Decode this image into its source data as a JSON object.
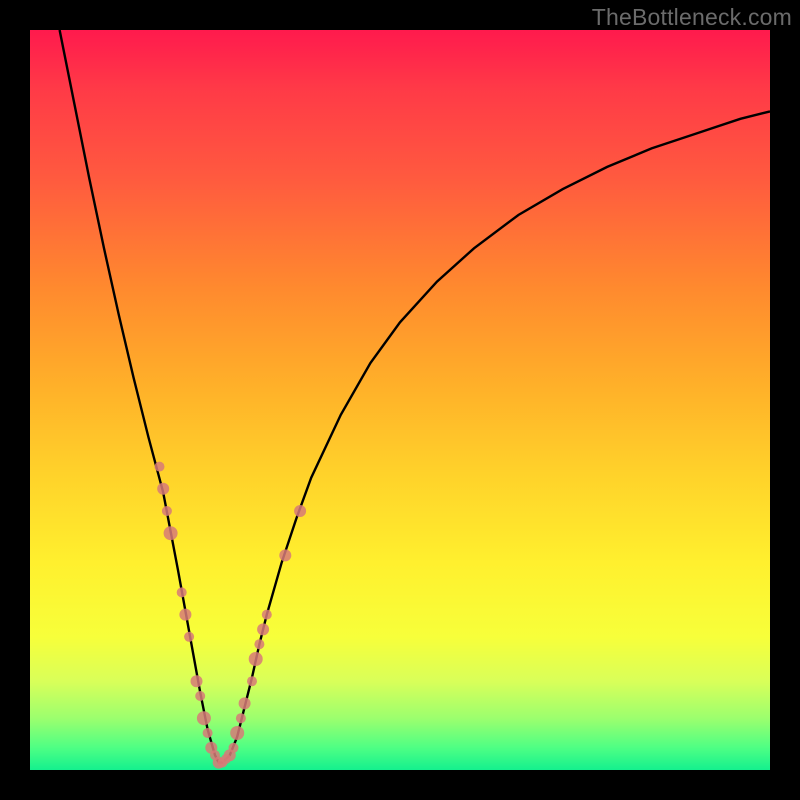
{
  "watermark": "TheBottleneck.com",
  "chart_data": {
    "type": "line",
    "title": "",
    "xlabel": "",
    "ylabel": "",
    "xlim": [
      0,
      100
    ],
    "ylim": [
      0,
      100
    ],
    "grid": false,
    "curve": {
      "name": "bottleneck-curve",
      "color": "#000000",
      "x": [
        4,
        6,
        8,
        10,
        12,
        14,
        16,
        18,
        20,
        21,
        22,
        23,
        24,
        25,
        25.5,
        26,
        27,
        28,
        29,
        30,
        31,
        32,
        34,
        36,
        38,
        42,
        46,
        50,
        55,
        60,
        66,
        72,
        78,
        84,
        90,
        96,
        100
      ],
      "y": [
        100,
        90,
        80,
        70.5,
        61.5,
        53,
        45,
        37.5,
        27,
        21.5,
        16,
        10.5,
        5.5,
        2,
        1,
        1,
        2,
        4.5,
        8.5,
        12.5,
        17,
        21,
        28,
        34,
        39.5,
        48,
        55,
        60.5,
        66,
        70.5,
        75,
        78.5,
        81.5,
        84,
        86,
        88,
        89
      ]
    },
    "scatter": {
      "name": "data-points",
      "color": "#d77a78",
      "points": [
        {
          "x": 17.5,
          "y": 41,
          "r": 5
        },
        {
          "x": 18.0,
          "y": 38,
          "r": 6
        },
        {
          "x": 18.5,
          "y": 35,
          "r": 5
        },
        {
          "x": 19.0,
          "y": 32,
          "r": 7
        },
        {
          "x": 20.5,
          "y": 24,
          "r": 5
        },
        {
          "x": 21.0,
          "y": 21,
          "r": 6
        },
        {
          "x": 21.5,
          "y": 18,
          "r": 5
        },
        {
          "x": 22.5,
          "y": 12,
          "r": 6
        },
        {
          "x": 23.0,
          "y": 10,
          "r": 5
        },
        {
          "x": 23.5,
          "y": 7,
          "r": 7
        },
        {
          "x": 24.0,
          "y": 5,
          "r": 5
        },
        {
          "x": 24.5,
          "y": 3,
          "r": 6
        },
        {
          "x": 25.0,
          "y": 2,
          "r": 5
        },
        {
          "x": 25.5,
          "y": 1,
          "r": 6
        },
        {
          "x": 26.0,
          "y": 1,
          "r": 5
        },
        {
          "x": 26.5,
          "y": 1.5,
          "r": 5
        },
        {
          "x": 27.0,
          "y": 2,
          "r": 6
        },
        {
          "x": 27.5,
          "y": 3,
          "r": 5
        },
        {
          "x": 28.0,
          "y": 5,
          "r": 7
        },
        {
          "x": 28.5,
          "y": 7,
          "r": 5
        },
        {
          "x": 29.0,
          "y": 9,
          "r": 6
        },
        {
          "x": 30.0,
          "y": 12,
          "r": 5
        },
        {
          "x": 30.5,
          "y": 15,
          "r": 7
        },
        {
          "x": 31.0,
          "y": 17,
          "r": 5
        },
        {
          "x": 31.5,
          "y": 19,
          "r": 6
        },
        {
          "x": 32.0,
          "y": 21,
          "r": 5
        },
        {
          "x": 34.5,
          "y": 29,
          "r": 6
        },
        {
          "x": 36.5,
          "y": 35,
          "r": 6
        }
      ]
    }
  }
}
